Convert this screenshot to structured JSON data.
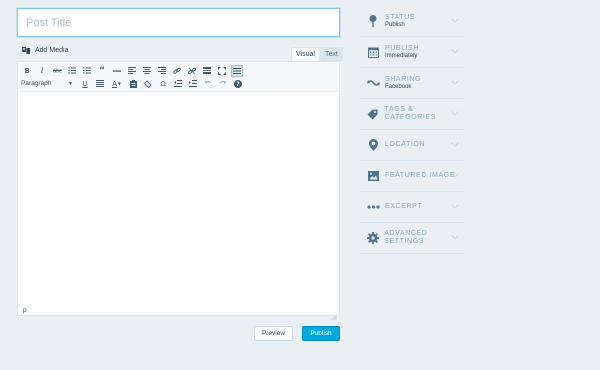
{
  "post": {
    "title_placeholder": "Post Title",
    "title_value": ""
  },
  "editor": {
    "add_media_label": "Add Media",
    "tabs": [
      {
        "label": "Visual",
        "active": true
      },
      {
        "label": "Text",
        "active": false
      }
    ],
    "toolbar_row1": [
      {
        "name": "bold-button",
        "glyph": "B"
      },
      {
        "name": "italic-button",
        "glyph": "I"
      },
      {
        "name": "strikethrough-button",
        "glyph": "abc"
      },
      {
        "name": "bullet-list-icon",
        "glyph": ""
      },
      {
        "name": "numbered-list-icon",
        "glyph": ""
      },
      {
        "name": "blockquote-button",
        "glyph": "“"
      },
      {
        "name": "horizontal-rule-button",
        "glyph": "—"
      },
      {
        "name": "align-left-icon",
        "glyph": ""
      },
      {
        "name": "align-center-icon",
        "glyph": ""
      },
      {
        "name": "align-right-icon",
        "glyph": ""
      },
      {
        "name": "link-icon",
        "glyph": ""
      },
      {
        "name": "unlink-icon",
        "glyph": ""
      },
      {
        "name": "read-more-icon",
        "glyph": ""
      },
      {
        "name": "fullscreen-icon",
        "glyph": ""
      },
      {
        "name": "toolbar-toggle-icon",
        "glyph": ""
      }
    ],
    "format_select": "Paragraph",
    "toolbar_row2": [
      {
        "name": "underline-button",
        "glyph": "U"
      },
      {
        "name": "justify-icon",
        "glyph": ""
      },
      {
        "name": "text-color-button",
        "glyph": "A"
      },
      {
        "name": "paste-text-icon",
        "glyph": ""
      },
      {
        "name": "clear-formatting-icon",
        "glyph": ""
      },
      {
        "name": "special-character-button",
        "glyph": "Ω"
      },
      {
        "name": "outdent-icon",
        "glyph": ""
      },
      {
        "name": "indent-icon",
        "glyph": ""
      },
      {
        "name": "undo-icon",
        "glyph": ""
      },
      {
        "name": "redo-icon",
        "glyph": ""
      },
      {
        "name": "help-icon",
        "glyph": "?"
      }
    ],
    "status_path": "p"
  },
  "actions": {
    "preview_label": "Preview",
    "publish_label": "Publish"
  },
  "sidebar": {
    "items": [
      {
        "name": "status",
        "title": "Status",
        "subtitle": "Publish",
        "icon": "pin-icon"
      },
      {
        "name": "publish",
        "title": "Publish",
        "subtitle": "Immediately",
        "icon": "calendar-icon"
      },
      {
        "name": "sharing",
        "title": "Sharing",
        "subtitle": "Facebook",
        "icon": "sharing-icon"
      },
      {
        "name": "tags-categories",
        "title": "Tags & Categories",
        "subtitle": "",
        "icon": "tag-icon"
      },
      {
        "name": "location",
        "title": "Location",
        "subtitle": "",
        "icon": "location-icon"
      },
      {
        "name": "featured-image",
        "title": "Featured Image",
        "subtitle": "",
        "icon": "image-icon"
      },
      {
        "name": "excerpt",
        "title": "Excerpt",
        "subtitle": "",
        "icon": "ellipsis-icon"
      },
      {
        "name": "advanced-settings",
        "title": "Advanced Settings",
        "subtitle": "",
        "icon": "gear-icon"
      }
    ]
  },
  "colors": {
    "page_bg": "#e9eff3",
    "accent": "#00aadc",
    "text": "#2e4453",
    "muted": "#87a6bc"
  }
}
